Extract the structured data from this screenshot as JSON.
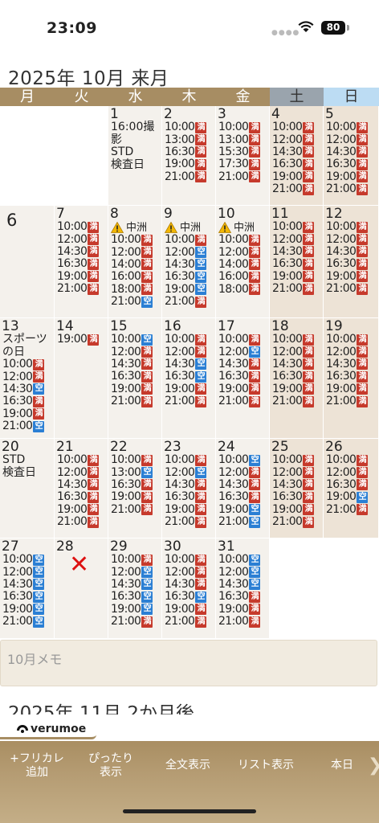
{
  "status": {
    "time": "23:09",
    "battery": "80"
  },
  "header": {
    "month_title": "2025年 10月 来月"
  },
  "weekdays": [
    "月",
    "火",
    "水",
    "木",
    "金",
    "土",
    "日"
  ],
  "calendar": {
    "weeks": [
      [
        {
          "empty": true
        },
        {
          "empty": true
        },
        {
          "day": "1",
          "notes": [
            "16:00撮",
            "影",
            "STD",
            "検査日"
          ]
        },
        {
          "day": "2",
          "slots": [
            [
              "10:00",
              "満"
            ],
            [
              "13:00",
              "満"
            ],
            [
              "16:30",
              "満"
            ],
            [
              "19:00",
              "満"
            ],
            [
              "21:00",
              "満"
            ]
          ]
        },
        {
          "day": "3",
          "slots": [
            [
              "10:00",
              "満"
            ],
            [
              "13:00",
              "満"
            ],
            [
              "15:30",
              "満"
            ],
            [
              "17:30",
              "満"
            ],
            [
              "21:00",
              "満"
            ]
          ]
        },
        {
          "day": "4",
          "slots": [
            [
              "10:00",
              "満"
            ],
            [
              "12:00",
              "満"
            ],
            [
              "14:30",
              "満"
            ],
            [
              "16:30",
              "満"
            ],
            [
              "19:00",
              "満"
            ],
            [
              "21:00",
              "満"
            ]
          ]
        },
        {
          "day": "5",
          "slots": [
            [
              "10:00",
              "満"
            ],
            [
              "12:00",
              "満"
            ],
            [
              "14:30",
              "満"
            ],
            [
              "16:30",
              "満"
            ],
            [
              "19:00",
              "満"
            ],
            [
              "21:00",
              "満"
            ]
          ]
        }
      ],
      [
        {
          "day": "6",
          "big": true
        },
        {
          "day": "7",
          "slots": [
            [
              "10:00",
              "満"
            ],
            [
              "12:00",
              "満"
            ],
            [
              "14:30",
              "満"
            ],
            [
              "16:30",
              "満"
            ],
            [
              "19:00",
              "満"
            ],
            [
              "21:00",
              "満"
            ]
          ]
        },
        {
          "day": "8",
          "warn": "中洲",
          "slots": [
            [
              "10:00",
              "満"
            ],
            [
              "12:00",
              "満"
            ],
            [
              "14:00",
              "満"
            ],
            [
              "16:00",
              "満"
            ],
            [
              "18:00",
              "満"
            ],
            [
              "21:00",
              "空"
            ]
          ]
        },
        {
          "day": "9",
          "warn": "中洲",
          "slots": [
            [
              "10:00",
              "満"
            ],
            [
              "12:00",
              "空"
            ],
            [
              "14:30",
              "空"
            ],
            [
              "16:30",
              "空"
            ],
            [
              "19:00",
              "空"
            ],
            [
              "21:00",
              "満"
            ]
          ]
        },
        {
          "day": "10",
          "warn": "中洲",
          "slots": [
            [
              "10:00",
              "満"
            ],
            [
              "12:00",
              "満"
            ],
            [
              "14:00",
              "満"
            ],
            [
              "16:00",
              "満"
            ],
            [
              "18:00",
              "満"
            ]
          ]
        },
        {
          "day": "11",
          "slots": [
            [
              "10:00",
              "満"
            ],
            [
              "12:00",
              "満"
            ],
            [
              "14:30",
              "満"
            ],
            [
              "16:30",
              "満"
            ],
            [
              "19:00",
              "満"
            ],
            [
              "21:00",
              "満"
            ]
          ]
        },
        {
          "day": "12",
          "slots": [
            [
              "10:00",
              "満"
            ],
            [
              "12:00",
              "満"
            ],
            [
              "14:30",
              "満"
            ],
            [
              "16:30",
              "満"
            ],
            [
              "19:00",
              "満"
            ],
            [
              "21:00",
              "満"
            ]
          ]
        }
      ],
      [
        {
          "day": "13",
          "notes": [
            "スポーツ",
            "の日"
          ],
          "slots": [
            [
              "10:00",
              "満"
            ],
            [
              "12:00",
              "満"
            ],
            [
              "14:30",
              "空"
            ],
            [
              "16:30",
              "満"
            ],
            [
              "19:00",
              "満"
            ],
            [
              "21:00",
              "空"
            ]
          ]
        },
        {
          "day": "14",
          "slots": [
            [
              "19:00",
              "満"
            ]
          ]
        },
        {
          "day": "15",
          "slots": [
            [
              "10:00",
              "空"
            ],
            [
              "12:00",
              "満"
            ],
            [
              "14:30",
              "満"
            ],
            [
              "16:30",
              "満"
            ],
            [
              "19:00",
              "満"
            ],
            [
              "21:00",
              "満"
            ]
          ]
        },
        {
          "day": "16",
          "slots": [
            [
              "10:00",
              "満"
            ],
            [
              "12:00",
              "満"
            ],
            [
              "14:30",
              "空"
            ],
            [
              "16:30",
              "空"
            ],
            [
              "19:00",
              "満"
            ],
            [
              "21:00",
              "満"
            ]
          ]
        },
        {
          "day": "17",
          "slots": [
            [
              "10:00",
              "満"
            ],
            [
              "12:00",
              "空"
            ],
            [
              "14:30",
              "満"
            ],
            [
              "16:30",
              "満"
            ],
            [
              "19:00",
              "満"
            ],
            [
              "21:00",
              "満"
            ]
          ]
        },
        {
          "day": "18",
          "slots": [
            [
              "10:00",
              "満"
            ],
            [
              "12:00",
              "満"
            ],
            [
              "14:30",
              "満"
            ],
            [
              "16:30",
              "満"
            ],
            [
              "19:00",
              "満"
            ],
            [
              "21:00",
              "満"
            ]
          ]
        },
        {
          "day": "19",
          "slots": [
            [
              "10:00",
              "満"
            ],
            [
              "12:00",
              "満"
            ],
            [
              "14:30",
              "満"
            ],
            [
              "16:30",
              "満"
            ],
            [
              "19:00",
              "満"
            ],
            [
              "21:00",
              "満"
            ]
          ]
        }
      ],
      [
        {
          "day": "20",
          "notes": [
            "STD",
            "検査日"
          ]
        },
        {
          "day": "21",
          "slots": [
            [
              "10:00",
              "満"
            ],
            [
              "12:00",
              "満"
            ],
            [
              "14:30",
              "満"
            ],
            [
              "16:30",
              "満"
            ],
            [
              "19:00",
              "満"
            ],
            [
              "21:00",
              "満"
            ]
          ]
        },
        {
          "day": "22",
          "slots": [
            [
              "10:00",
              "満"
            ],
            [
              "13:00",
              "空"
            ],
            [
              "16:30",
              "満"
            ],
            [
              "19:00",
              "満"
            ],
            [
              "21:00",
              "満"
            ]
          ]
        },
        {
          "day": "23",
          "slots": [
            [
              "10:00",
              "満"
            ],
            [
              "12:00",
              "空"
            ],
            [
              "14:30",
              "満"
            ],
            [
              "16:30",
              "満"
            ],
            [
              "19:00",
              "満"
            ],
            [
              "21:00",
              "満"
            ]
          ]
        },
        {
          "day": "24",
          "slots": [
            [
              "10:00",
              "空"
            ],
            [
              "12:00",
              "満"
            ],
            [
              "14:30",
              "満"
            ],
            [
              "16:30",
              "満"
            ],
            [
              "19:00",
              "空"
            ],
            [
              "21:00",
              "空"
            ]
          ]
        },
        {
          "day": "25",
          "slots": [
            [
              "10:00",
              "満"
            ],
            [
              "12:00",
              "満"
            ],
            [
              "14:30",
              "満"
            ],
            [
              "16:30",
              "満"
            ],
            [
              "19:00",
              "満"
            ],
            [
              "21:00",
              "満"
            ]
          ]
        },
        {
          "day": "26",
          "slots": [
            [
              "10:00",
              "満"
            ],
            [
              "12:00",
              "満"
            ],
            [
              "16:30",
              "満"
            ],
            [
              "19:00",
              "空"
            ],
            [
              "21:00",
              "満"
            ]
          ]
        }
      ],
      [
        {
          "day": "27",
          "slots": [
            [
              "10:00",
              "空"
            ],
            [
              "12:00",
              "空"
            ],
            [
              "14:30",
              "空"
            ],
            [
              "16:30",
              "空"
            ],
            [
              "19:00",
              "空"
            ],
            [
              "21:00",
              "空"
            ]
          ]
        },
        {
          "day": "28",
          "closed": true
        },
        {
          "day": "29",
          "slots": [
            [
              "10:00",
              "満"
            ],
            [
              "12:00",
              "空"
            ],
            [
              "14:30",
              "空"
            ],
            [
              "16:30",
              "空"
            ],
            [
              "19:00",
              "空"
            ],
            [
              "21:00",
              "満"
            ]
          ]
        },
        {
          "day": "30",
          "slots": [
            [
              "10:00",
              "満"
            ],
            [
              "12:00",
              "満"
            ],
            [
              "14:30",
              "満"
            ],
            [
              "16:30",
              "空"
            ],
            [
              "19:00",
              "満"
            ],
            [
              "21:00",
              "満"
            ]
          ]
        },
        {
          "day": "31",
          "slots": [
            [
              "10:00",
              "空"
            ],
            [
              "12:00",
              "空"
            ],
            [
              "14:30",
              "空"
            ],
            [
              "16:30",
              "満"
            ],
            [
              "19:00",
              "満"
            ],
            [
              "21:00",
              "満"
            ]
          ]
        },
        {
          "empty": true
        },
        {
          "empty": true
        }
      ]
    ]
  },
  "memo": {
    "label": "10月メモ"
  },
  "next_month": {
    "title": "2025年 11月 2か月後"
  },
  "logo": {
    "text": "verumoe"
  },
  "toolbar": {
    "add_free_line1": "+フリカレ",
    "add_free_line2": "追加",
    "fit_line1": "ぴったり",
    "fit_line2": "表示",
    "full_text": "全文表示",
    "list_view": "リスト表示",
    "today": "本日",
    "next": "❯"
  },
  "colors": {
    "header_bg": "#a78d63",
    "full": "#c63a2c",
    "free": "#2b7fd4",
    "weekend_cell": "#ede3d6",
    "weekday_cell": "#f4f1ec"
  }
}
